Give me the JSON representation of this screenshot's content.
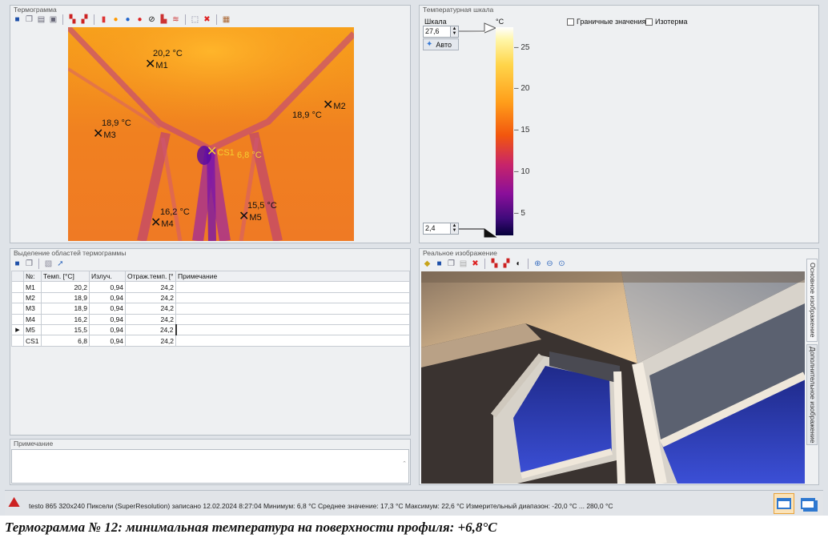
{
  "thermogram_panel": {
    "title": "Термограмма",
    "markers": [
      {
        "name": "M1",
        "temp": "20,2 °C"
      },
      {
        "name": "M2",
        "temp": "18,9 °C"
      },
      {
        "name": "M3",
        "temp": "18,9 °C"
      },
      {
        "name": "M4",
        "temp": "16,2 °C"
      },
      {
        "name": "M5",
        "temp": "15,5 °C"
      },
      {
        "name": "CS1",
        "temp": "6,8 °C"
      }
    ]
  },
  "scale_panel": {
    "title": "Температурная шкала",
    "scale_label": "Шкала",
    "max_value": "27,6",
    "min_value": "2,4",
    "auto_label": "Авто",
    "unit": "°C",
    "ticks": [
      "25",
      "20",
      "15",
      "10",
      "5"
    ],
    "checkbox_limits": "Граничные значения",
    "checkbox_isotherm": "Изотерма",
    "colors": {
      "hot": "#ffffff",
      "mid": "#f2560e",
      "cold": "#05003a"
    }
  },
  "regions_panel": {
    "title": "Выделение областей термограммы",
    "columns": [
      "№:",
      "Темп. [°C]",
      "Излуч.",
      "Отраж.темп. [°",
      "Примечание"
    ],
    "rows": [
      {
        "id": "M1",
        "temp": "20,2",
        "emis": "0,94",
        "refl": "24,2",
        "note": ""
      },
      {
        "id": "M2",
        "temp": "18,9",
        "emis": "0,94",
        "refl": "24,2",
        "note": ""
      },
      {
        "id": "M3",
        "temp": "18,9",
        "emis": "0,94",
        "refl": "24,2",
        "note": ""
      },
      {
        "id": "M4",
        "temp": "16,2",
        "emis": "0,94",
        "refl": "24,2",
        "note": ""
      },
      {
        "id": "M5",
        "temp": "15,5",
        "emis": "0,94",
        "refl": "24,2",
        "note": ""
      },
      {
        "id": "CS1",
        "temp": "6,8",
        "emis": "0,94",
        "refl": "24,2",
        "note": ""
      }
    ],
    "selected_row": "M5"
  },
  "note_panel": {
    "title": "Примечание",
    "value": ""
  },
  "real_image_panel": {
    "title": "Реальное изображение",
    "tab_main": "Основное изображение",
    "tab_extra": "Дополнительное изображение"
  },
  "status_bar": {
    "text": "testo 865 320x240 Пиксели (SuperResolution) записано 12.02.2024 8:27:04  Минимум: 6,8 °C  Среднее значение: 17,3 °C  Максимум: 22,6 °C  Измерительный диапазон: -20,0 °C ... 280,0 °C"
  },
  "caption": "Термограмма № 12: минимальная температура на поверхности профиля: +6,8°С"
}
